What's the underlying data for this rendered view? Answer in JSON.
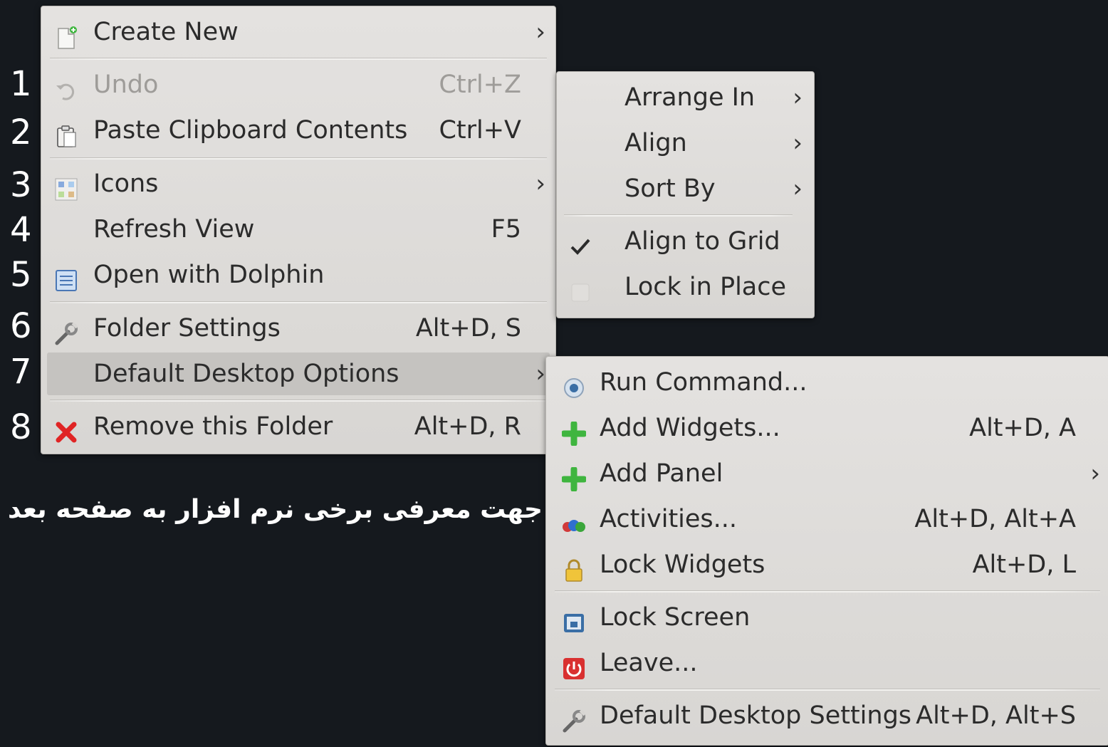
{
  "numbers": [
    "1",
    "2",
    "3",
    "4",
    "5",
    "6",
    "7",
    "8"
  ],
  "caption": "جهت معرفی برخی نرم افزار به صفحه بعد م",
  "main_menu": {
    "create_new": "Create New",
    "undo": "Undo",
    "undo_shortcut": "Ctrl+Z",
    "paste": "Paste Clipboard Contents",
    "paste_shortcut": "Ctrl+V",
    "icons": "Icons",
    "refresh": "Refresh View",
    "refresh_shortcut": "F5",
    "open_dolphin": "Open with Dolphin",
    "folder_settings": "Folder Settings",
    "folder_settings_shortcut": "Alt+D, S",
    "default_desktop_options": "Default Desktop Options",
    "remove_folder": "Remove this Folder",
    "remove_folder_shortcut": "Alt+D, R"
  },
  "arrange_menu": {
    "arrange_in": "Arrange In",
    "align": "Align",
    "sort_by": "Sort By",
    "align_to_grid": "Align to Grid",
    "align_to_grid_checked": true,
    "lock_in_place": "Lock in Place",
    "lock_in_place_checked": false
  },
  "desktop_menu": {
    "run_command": "Run Command...",
    "add_widgets": "Add Widgets...",
    "add_widgets_shortcut": "Alt+D, A",
    "add_panel": "Add Panel",
    "activities": "Activities...",
    "activities_shortcut": "Alt+D, Alt+A",
    "lock_widgets": "Lock Widgets",
    "lock_widgets_shortcut": "Alt+D, L",
    "lock_screen": "Lock Screen",
    "leave": "Leave...",
    "default_desktop_settings": "Default Desktop Settings",
    "default_desktop_settings_shortcut": "Alt+D, Alt+S"
  },
  "colors": {
    "background": "#15191e",
    "menu_bg": "#dddbd8",
    "highlight": "#c5c3c0",
    "text": "#2b2b2b",
    "disabled_text": "#9e9c99",
    "add_green": "#3fb53f",
    "remove_red": "#e02424"
  }
}
